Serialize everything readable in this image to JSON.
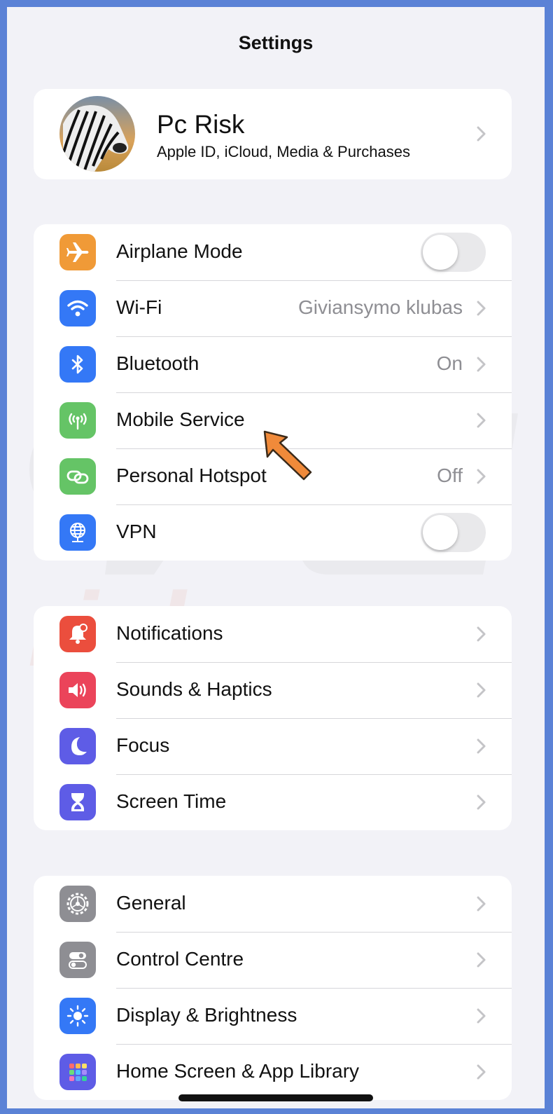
{
  "header": {
    "title": "Settings"
  },
  "profile": {
    "name": "Pc Risk",
    "subtitle": "Apple ID, iCloud, Media & Purchases"
  },
  "connectivity": [
    {
      "label": "Airplane Mode",
      "icon": "airplane-icon",
      "color": "#f09a37",
      "toggle": false
    },
    {
      "label": "Wi-Fi",
      "icon": "wifi-icon",
      "color": "#3478f6",
      "value": "Giviansymo klubas"
    },
    {
      "label": "Bluetooth",
      "icon": "bluetooth-icon",
      "color": "#3478f6",
      "value": "On"
    },
    {
      "label": "Mobile Service",
      "icon": "antenna-icon",
      "color": "#65c466"
    },
    {
      "label": "Personal Hotspot",
      "icon": "hotspot-icon",
      "color": "#65c466",
      "value": "Off"
    },
    {
      "label": "VPN",
      "icon": "globe-icon",
      "color": "#3478f6",
      "toggle": false
    }
  ],
  "attention": [
    {
      "label": "Notifications",
      "icon": "bell-icon",
      "color": "#eb4e3d"
    },
    {
      "label": "Sounds & Haptics",
      "icon": "speaker-icon",
      "color": "#eb445a"
    },
    {
      "label": "Focus",
      "icon": "moon-icon",
      "color": "#5e5ce6"
    },
    {
      "label": "Screen Time",
      "icon": "hourglass-icon",
      "color": "#5e5ce6"
    }
  ],
  "general": [
    {
      "label": "General",
      "icon": "gear-icon",
      "color": "#8e8e93"
    },
    {
      "label": "Control Centre",
      "icon": "switches-icon",
      "color": "#8e8e93"
    },
    {
      "label": "Display & Brightness",
      "icon": "sun-icon",
      "color": "#3478f6"
    },
    {
      "label": "Home Screen & App Library",
      "icon": "grid-icon",
      "color": "#5e5ce6"
    }
  ]
}
